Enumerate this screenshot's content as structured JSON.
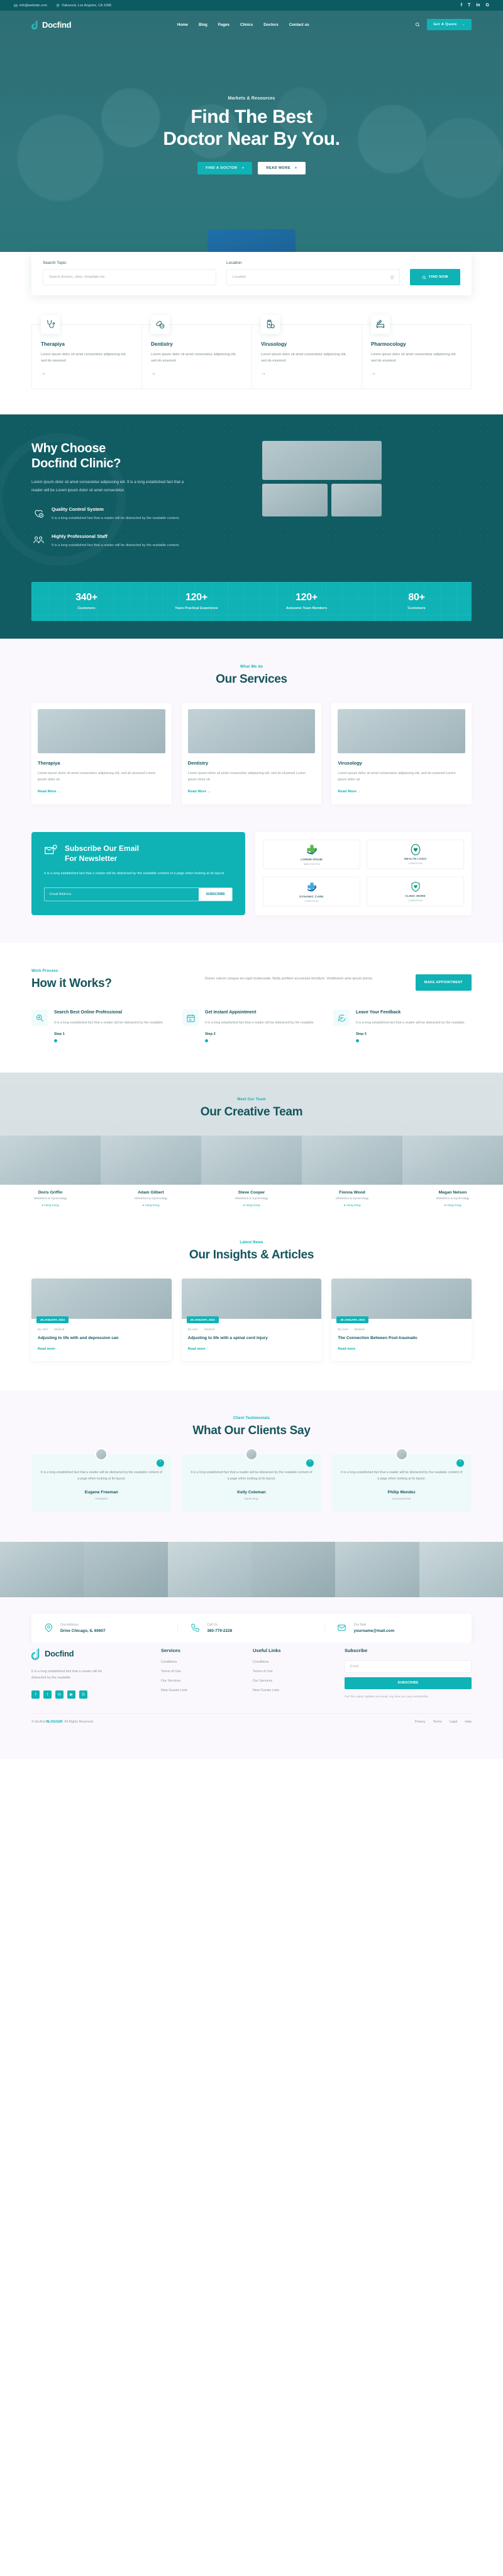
{
  "topbar": {
    "email": "info@website.com",
    "address": "Oakwood, Los Angeles, CA 1098",
    "socials": [
      "f",
      "𝑭",
      "in",
      "G"
    ]
  },
  "nav": {
    "brand": "Docfind",
    "items": [
      "Home",
      "Blog",
      "Pages",
      "Clinics",
      "Doctors",
      "Contact us"
    ],
    "cta": "Get A Quote"
  },
  "hero": {
    "eyebrow": "Markets & Resources",
    "title_line1": "Find The Best",
    "title_line2": "Doctor Near By You.",
    "btn_primary": "FIND A DOCTOR",
    "btn_secondary": "READ MORE"
  },
  "search": {
    "topic_label": "Search Topic",
    "topic_placeholder": "Search doctors, clinic, Hospitals etc.",
    "location_label": "Location",
    "location_placeholder": "Location",
    "button": "FIND NOW"
  },
  "specialties": [
    {
      "icon": "stethoscope-icon",
      "title": "Therapiya",
      "text": "Lorem ipsum dolor sit amet consectetur adipisicing elit, sed do eiusmod"
    },
    {
      "icon": "pills-icon",
      "title": "Dentistry",
      "text": "Lorem ipsum dolor sit amet consectetur adipisicing elit, sed do eiusmod"
    },
    {
      "icon": "medicine-bottle-icon",
      "title": "Virusology",
      "text": "Lorem ipsum dolor sit amet consectetur adipisicing elit, sed do eiusmod"
    },
    {
      "icon": "hospital-bed-icon",
      "title": "Pharmocology",
      "text": "Lorem ipsum dolor sit amet consectetur adipisicing elit, sed do eiusmod"
    }
  ],
  "why": {
    "title_line1": "Why Choose",
    "title_line2": "Docfind Clinic?",
    "lead": "Lorem ipsum dolor sit amet consectetur adipisicing elit. It is a long established fact that a reader will be Lorem ipsum dolor sit amet consectetur.",
    "features": [
      {
        "icon": "heart-check-icon",
        "title": "Quality Control System",
        "text": "It is a long established fact that a reader will be distracted by the readable content."
      },
      {
        "icon": "staff-icon",
        "title": "Highly Professional Staff",
        "text": "It is a long established fact that a reader will be distracted by the readable content."
      }
    ]
  },
  "stats": [
    {
      "number": "340+",
      "label": "Customers"
    },
    {
      "number": "120+",
      "label": "Years Practical Experience"
    },
    {
      "number": "120+",
      "label": "Awesome Team Members"
    },
    {
      "number": "80+",
      "label": "Customers"
    }
  ],
  "services": {
    "eyebrow": "What We do",
    "title": "Our Services",
    "items": [
      {
        "title": "Therapiya",
        "text": "Lorem ipsum dolor sit amet consectetur adipisicing elit, sed do eiusmod Lorem ipsum dolor sit.",
        "link": "Read More"
      },
      {
        "title": "Dentistry",
        "text": "Lorem ipsum dolor sit amet consectetur adipisicing elit, sed do eiusmod Lorem ipsum dolor sit.",
        "link": "Read More"
      },
      {
        "title": "Virusology",
        "text": "Lorem ipsum dolor sit amet consectetur adipisicing elit, sed do eiusmod Lorem ipsum dolor sit.",
        "link": "Read More"
      }
    ]
  },
  "newsletter": {
    "title_line1": "Subscribe Our Email",
    "title_line2": "For Newsletter",
    "text": "It is a long established fact that a reader will be distracted by the readable content of a page when looking at its layout.",
    "placeholder": "Email Address",
    "button": "SUBSCRIBE"
  },
  "partner_logos": [
    {
      "name": "LOREM IPSUM",
      "sub": "Tagline Goes Here"
    },
    {
      "name": "HEALTH LOGO",
      "sub": "LOREM IPSUM"
    },
    {
      "name": "DYNAMIC CARE",
      "sub": "LOREM IPSUM"
    },
    {
      "name": "CLINIC MORE",
      "sub": "LOREM IPSUM"
    }
  ],
  "how": {
    "eyebrow": "Work Process",
    "title": "How it Works?",
    "text": "Donec rutrum congue leo eget malesuada. Nulla porttitor accumsan tincidunt. Vestibulum ante ipsum primis.",
    "cta": "MAKE APPOINTMENT",
    "steps": [
      {
        "icon": "search-doctor-icon",
        "title": "Search Best Online Professional",
        "text": "It is a long established fact that a reader will be distracted by the readable.",
        "step": "Step 1"
      },
      {
        "icon": "calendar-icon",
        "title": "Get Instant Appointment",
        "text": "It is a long established fact that a reader will be distracted by the readable.",
        "step": "Step 2"
      },
      {
        "icon": "feedback-icon",
        "title": "Leave Your Feedback",
        "text": "It is a long established fact that a reader will be distracted by the readable.",
        "step": "Step 3"
      }
    ]
  },
  "team": {
    "eyebrow": "Meet Our Team",
    "title": "Our Creative Team",
    "members": [
      {
        "name": "Doris Griffin",
        "role": "Obstetrics & Gynecology",
        "location": "Hong Kong"
      },
      {
        "name": "Adam Gilbert",
        "role": "Obstetrics & Gynecology",
        "location": "Hong Kong"
      },
      {
        "name": "Steve Cooper",
        "role": "Obstetrics & Gynecology",
        "location": "Hong Kong"
      },
      {
        "name": "Fionna Wood",
        "role": "Obstetrics & Gynecology",
        "location": "Hong Kong"
      },
      {
        "name": "Megan Nelson",
        "role": "Obstetrics & Gynecology",
        "location": "Hong Kong"
      }
    ]
  },
  "blog": {
    "eyebrow": "Latest News",
    "title": "Our Insights & Articles",
    "posts": [
      {
        "date": "28 JANUARY, 2023",
        "author": "By User",
        "category": "Medical",
        "title": "Adjusting to life with and depression can",
        "link": "Read more"
      },
      {
        "date": "28 JANUARY, 2023",
        "author": "By User",
        "category": "Medical",
        "title": "Adjusting to life with a spinal cord injury",
        "link": "Read more"
      },
      {
        "date": "28 JANUARY, 2023",
        "author": "By User",
        "category": "Medical",
        "title": "The Connection Between Post-traumatic",
        "link": "Read more"
      }
    ]
  },
  "testimonials": {
    "eyebrow": "Client Testimonials",
    "title": "What Our Clients Say",
    "items": [
      {
        "text": "It is a long established fact that a reader will be distracted by the readable content of a page when looking at its layout.",
        "name": "Eugene Freeman",
        "role": "President"
      },
      {
        "text": "It is a long established fact that a reader will be distracted by the readable content of a page when looking at its layout.",
        "name": "Kelly Coleman",
        "role": "Nurse Rep."
      },
      {
        "text": "It is a long established fact that a reader will be distracted by the readable content of a page when looking at its layout.",
        "name": "Philip Mendez",
        "role": "Consumer/Hut"
      }
    ]
  },
  "contact": [
    {
      "icon": "map-pin-icon",
      "label": "Our Address",
      "value": "Drive Chicago, IL 60607"
    },
    {
      "icon": "phone-icon",
      "label": "Call Us",
      "value": "360-779-2228"
    },
    {
      "icon": "mail-icon",
      "label": "Our Mail",
      "value": "yourname@mail.com"
    }
  ],
  "footer": {
    "brand": "Docfind",
    "about": "It is a long established fact that a reader will be distracted by the readable.",
    "socials": [
      "f",
      "t",
      "in",
      "▶",
      "G"
    ],
    "services_title": "Services",
    "services": [
      "Conditions",
      "Terms of Use",
      "Our Services",
      "New Guests Lists"
    ],
    "useful_title": "Useful Links",
    "useful": [
      "Conditions",
      "Terms of Use",
      "Our Services",
      "New Guests Lists"
    ],
    "subscribe_title": "Subscribe",
    "subscribe_placeholder": "Email",
    "subscribe_button": "SUBSCRIBE",
    "subscribe_note": "Get The Latest Updates via email. Any time you may unsubscribe",
    "copyright_prefix": "© docfind ",
    "copyright_brand": "BLOGGER",
    "copyright_suffix": ". All Rights Reserved",
    "bottom_links": [
      "Privacy",
      "Terms",
      "Legal",
      "Help"
    ]
  },
  "colors": {
    "brand_dark": "#14555c",
    "brand_teal": "#0fb2b5",
    "hero_overlay": "#0d5b62",
    "section_bg": "#fbf8fd"
  }
}
